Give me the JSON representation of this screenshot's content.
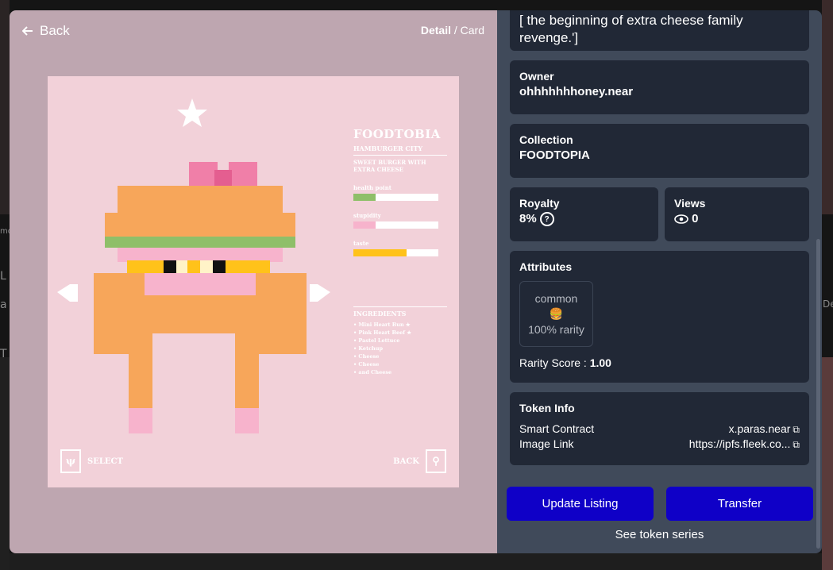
{
  "background": {
    "side_text_left": [
      "mo",
      "L",
      "a",
      "T"
    ],
    "side_text_right": [
      "De"
    ]
  },
  "media": {
    "back_label": "Back",
    "view_toggle": {
      "active": "Detail",
      "separator": " / ",
      "inactive": "Card"
    },
    "card": {
      "brand_title": "FOODTOBIA",
      "brand_subtitle": "HAMBURGER CITY",
      "description": "SWEET BURGER WITH EXTRA CHEESE",
      "stats": [
        {
          "label": "health point",
          "value": 0.26,
          "color": "#8fbf69"
        },
        {
          "label": "stupidity",
          "value": 0.26,
          "color": "#f7b3cc"
        },
        {
          "label": "taste",
          "value": 0.63,
          "color": "#ffc21a"
        }
      ],
      "ingredients_title": "INGREDIENTS",
      "ingredients": [
        "Mini Heart Bun ★",
        "Pink Heart Beef ★",
        "Pastel Lettuce",
        "Ketchup",
        "Cheese",
        "Cheese",
        "and Cheese"
      ],
      "select_label": "SELECT",
      "back_label": "BACK"
    }
  },
  "info": {
    "description": "[ the beginning of extra cheese family revenge.']",
    "owner_title": "Owner",
    "owner_value": "ohhhhhhhoney.near",
    "collection_title": "Collection",
    "collection_value": "FOODTOPIA",
    "royalty_title": "Royalty",
    "royalty_value": "8%",
    "views_title": "Views",
    "views_value": "0",
    "attributes_title": "Attributes",
    "attribute": {
      "name": "common",
      "icon": "🍔",
      "rarity": "100% rarity"
    },
    "rarity_score_label": "Rarity Score : ",
    "rarity_score_value": "1.00",
    "token_info_title": "Token Info",
    "smart_contract_label": "Smart Contract",
    "smart_contract_value": "x.paras.near",
    "image_link_label": "Image Link",
    "image_link_value": "https://ipfs.fleek.co...",
    "update_listing_label": "Update Listing",
    "transfer_label": "Transfer",
    "see_series_label": "See token series",
    "button_color": "#0f00c7"
  }
}
